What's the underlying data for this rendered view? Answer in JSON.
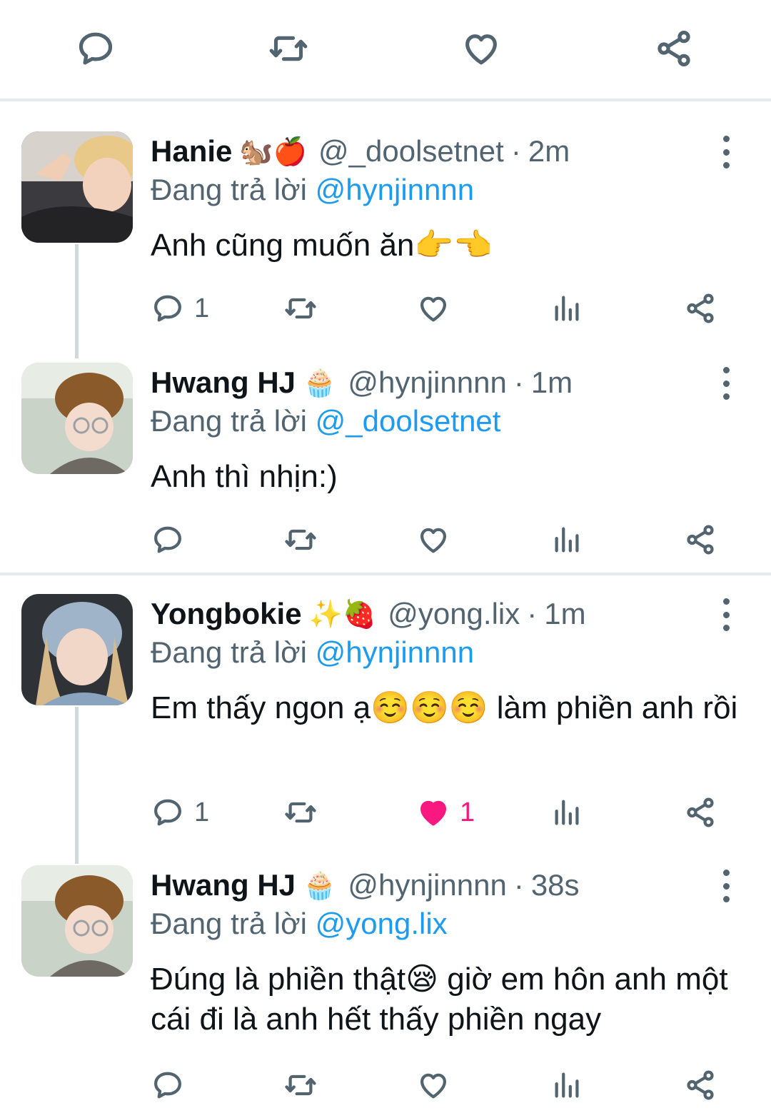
{
  "replying_to_label": "Đang trả lời",
  "colors": {
    "accent": "#1d9bf0",
    "like": "#f91880",
    "muted": "#536471"
  },
  "top_actions": [
    "reply-icon",
    "retweet-icon",
    "like-icon",
    "share-icon"
  ],
  "tweets": [
    {
      "display_name": "Hanie",
      "name_emoji": "🐿️🍎",
      "handle": "@_doolsetnet",
      "separator": "·",
      "time": "2m",
      "replying_to": "@hynjinnnn",
      "text": "Anh cũng muốn ăn👉👈",
      "reply_count": "1",
      "retweet_count": "",
      "like_count": ""
    },
    {
      "display_name": "Hwang HJ",
      "name_emoji": "🧁",
      "handle": "@hynjinnnn",
      "separator": "·",
      "time": "1m",
      "replying_to": "@_doolsetnet",
      "text": "Anh thì nhịn:)",
      "reply_count": "",
      "retweet_count": "",
      "like_count": ""
    },
    {
      "display_name": "Yongbokie",
      "name_emoji": "✨🍓",
      "handle": "@yong.lix",
      "separator": "·",
      "time": "1m",
      "replying_to": "@hynjinnnn",
      "text": "Em thấy ngon ạ☺️☺️☺️ làm phiền anh rồi",
      "reply_count": "1",
      "retweet_count": "",
      "like_count": "1"
    },
    {
      "display_name": "Hwang HJ",
      "name_emoji": "🧁",
      "handle": "@hynjinnnn",
      "separator": "·",
      "time": "38s",
      "replying_to": "@yong.lix",
      "text": "Đúng là phiền thật😪 giờ em hôn anh một cái đi là anh hết thấy phiền ngay",
      "reply_count": "",
      "retweet_count": "",
      "like_count": ""
    }
  ]
}
